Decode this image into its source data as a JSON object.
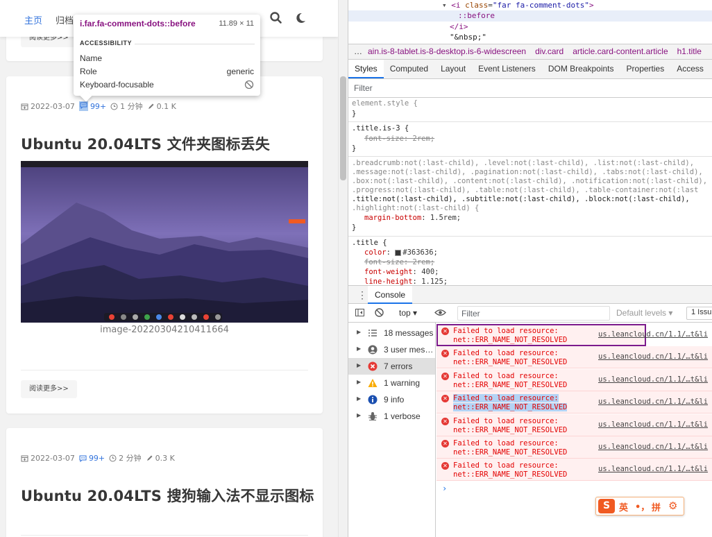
{
  "nav": {
    "home": "主页",
    "archive": "归档",
    "search_icon": "search-icon",
    "theme_icon": "moon-icon"
  },
  "card_prev": {
    "read_more": "阅读更多>>"
  },
  "card1": {
    "date": "2022-03-07",
    "comments": "99+",
    "read_time": "1 分钟",
    "words": "0.1 K",
    "title": "Ubuntu 20.04LTS 文件夹图标丢失",
    "caption": "image-20220304210411664",
    "read_more": "阅读更多>>"
  },
  "card2": {
    "date": "2022-03-07",
    "comments": "99+",
    "read_time": "2 分钟",
    "words": "0.3 K",
    "title": "Ubuntu 20.04LTS 搜狗输入法不显示图标"
  },
  "tooltip": {
    "selector": "i.far.fa-comment-dots::before",
    "dims": "11.89 × 11",
    "section": "ACCESSIBILITY",
    "rows": [
      {
        "label": "Name",
        "value": ""
      },
      {
        "label": "Role",
        "value": "generic"
      },
      {
        "label": "Keyboard-focusable",
        "value": ""
      }
    ]
  },
  "devtools": {
    "dom": {
      "line1_tag": "<i",
      "line1_attr": "class",
      "line1_val": "\"far fa-comment-dots\"",
      "line2": "::before",
      "line3": "</i>",
      "line4": "\"&nbsp;\""
    },
    "breadcrumbs": [
      "ain.is-8-tablet.is-8-desktop.is-6-widescreen",
      "div.card",
      "article.card-content.article",
      "h1.title"
    ],
    "breadcrumb_dots": "…",
    "tabs": [
      "Styles",
      "Computed",
      "Layout",
      "Event Listeners",
      "DOM Breakpoints",
      "Properties",
      "Access"
    ],
    "filter_placeholder": "Filter",
    "styles": {
      "r1_sel": "element.style {",
      "close": "}",
      "r2_sel": ".title.is-3 {",
      "r2_p1": "font-size: 2rem;",
      "r3_lines": [
        ".breadcrumb:not(:last-child), .level:not(:last-child), .list:not(:last-child),",
        ".message:not(:last-child), .pagination:not(:last-child), .tabs:not(:last-child),",
        ".box:not(:last-child), .content:not(:last-child), .notification:not(:last-child),",
        ".progress:not(:last-child), .table:not(:last-child), .table-container:not(:last",
        ".title:not(:last-child), .subtitle:not(:last-child), .block:not(:last-child),",
        ".highlight:not(:last-child) {"
      ],
      "r3_prop": "margin-bottom",
      "r3_val": ": 1.5rem;",
      "r4_sel": ".title {",
      "r4_color_prop": "color",
      "r4_color_val": "#363636;",
      "r4_fs": "font-size: 2rem;",
      "r4_fw_prop": "font-weight",
      "r4_fw_val": ": 400;",
      "r4_lh_prop": "line-height",
      "r4_lh_val": ": 1.125;"
    },
    "console_tab": "Console",
    "toolbar": {
      "context": "top",
      "filter_placeholder": "Filter",
      "levels": "Default levels",
      "issues": "1 Issu"
    },
    "sidebar": [
      {
        "label": "18 messages",
        "icon": "list-icon",
        "color": "#666666"
      },
      {
        "label": "3 user mes…",
        "icon": "user-icon",
        "color": "#666666"
      },
      {
        "label": "7 errors",
        "icon": "error-icon",
        "color": "#e53935"
      },
      {
        "label": "1 warning",
        "icon": "warning-icon",
        "color": "#f9ab00"
      },
      {
        "label": "9 info",
        "icon": "info-icon",
        "color": "#1a73e8"
      },
      {
        "label": "1 verbose",
        "icon": "bug-icon",
        "color": "#666666"
      }
    ],
    "messages": [
      {
        "l1": "Failed to load resource:",
        "l2": "net::ERR_NAME_NOT_RESOLVED",
        "src": "us.leancloud.cn/1.1/…t&li"
      },
      {
        "l1": "Failed to load resource:",
        "l2": "net::ERR_NAME_NOT_RESOLVED",
        "src": "us.leancloud.cn/1.1/…t&li"
      },
      {
        "l1": "Failed to load resource:",
        "l2": "net::ERR_NAME_NOT_RESOLVED",
        "src": "us.leancloud.cn/1.1/…t&li"
      },
      {
        "l1": "Failed to load resource:",
        "l2": "net::ERR_NAME_NOT_RESOLVED",
        "src": "us.leancloud.cn/1.1/…t&li"
      },
      {
        "l1": "Failed to load resource:",
        "l2": "net::ERR_NAME_NOT_RESOLVED",
        "src": "us.leancloud.cn/1.1/…t&li"
      },
      {
        "l1": "Failed to load resource:",
        "l2": "net::ERR_NAME_NOT_RESOLVED",
        "src": "us.leancloud.cn/1.1/…t&li"
      },
      {
        "l1": "Failed to load resource:",
        "l2": "net::ERR_NAME_NOT_RESOLVED",
        "src": "us.leancloud.cn/1.1/…t&li"
      }
    ],
    "prompt": "›"
  },
  "ime": {
    "logo": "S",
    "mode": "英",
    "punct": "•，",
    "pinyin": "拼",
    "settings_icon": "gear-icon"
  }
}
